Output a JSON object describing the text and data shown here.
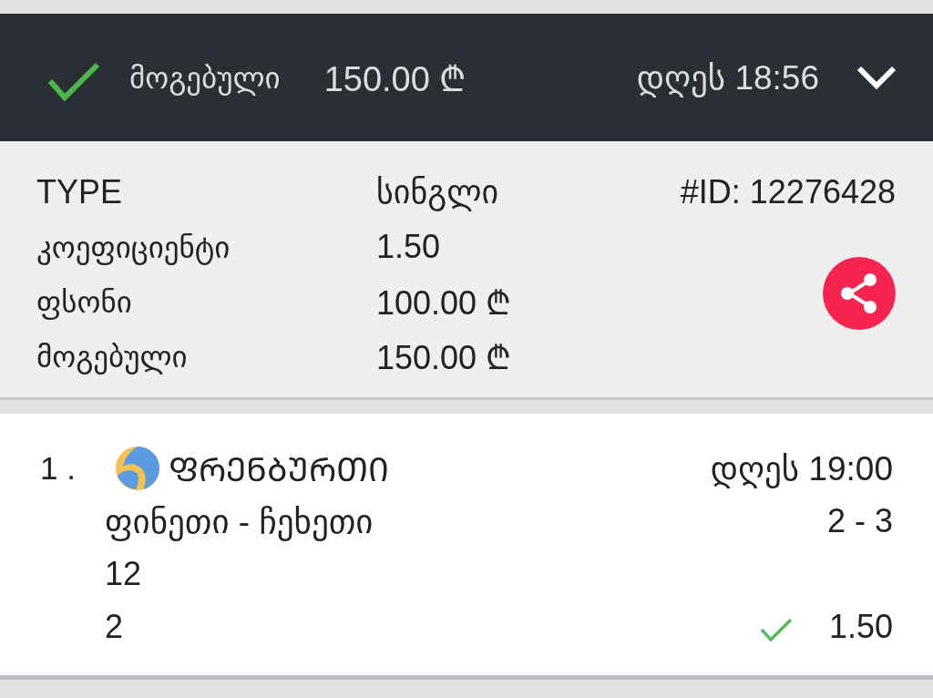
{
  "header": {
    "won": true,
    "status_label": "მოგებული",
    "amount": "150.00 ₾",
    "time": "დღეს 18:56",
    "expanded": true
  },
  "details": {
    "rows": [
      {
        "label": "TYPE",
        "value": "სინგლი"
      },
      {
        "label": "კოეფიციენტი",
        "value": "1.50"
      },
      {
        "label": "ფსონი",
        "value": "100.00 ₾"
      },
      {
        "label": "მოგებული",
        "value": "150.00 ₾"
      }
    ],
    "bet_id": "#ID: 12276428"
  },
  "events": [
    {
      "number": "1 .",
      "sport": "ᲤᲠᲔᲜᲑᲣᲠᲗᲘ",
      "time": "დღეს 19:00",
      "teams": "ფინეთი - ჩეხეთი",
      "score": "2 - 3",
      "market": "12",
      "pick": "2",
      "won": true,
      "odds": "1.50"
    }
  ]
}
